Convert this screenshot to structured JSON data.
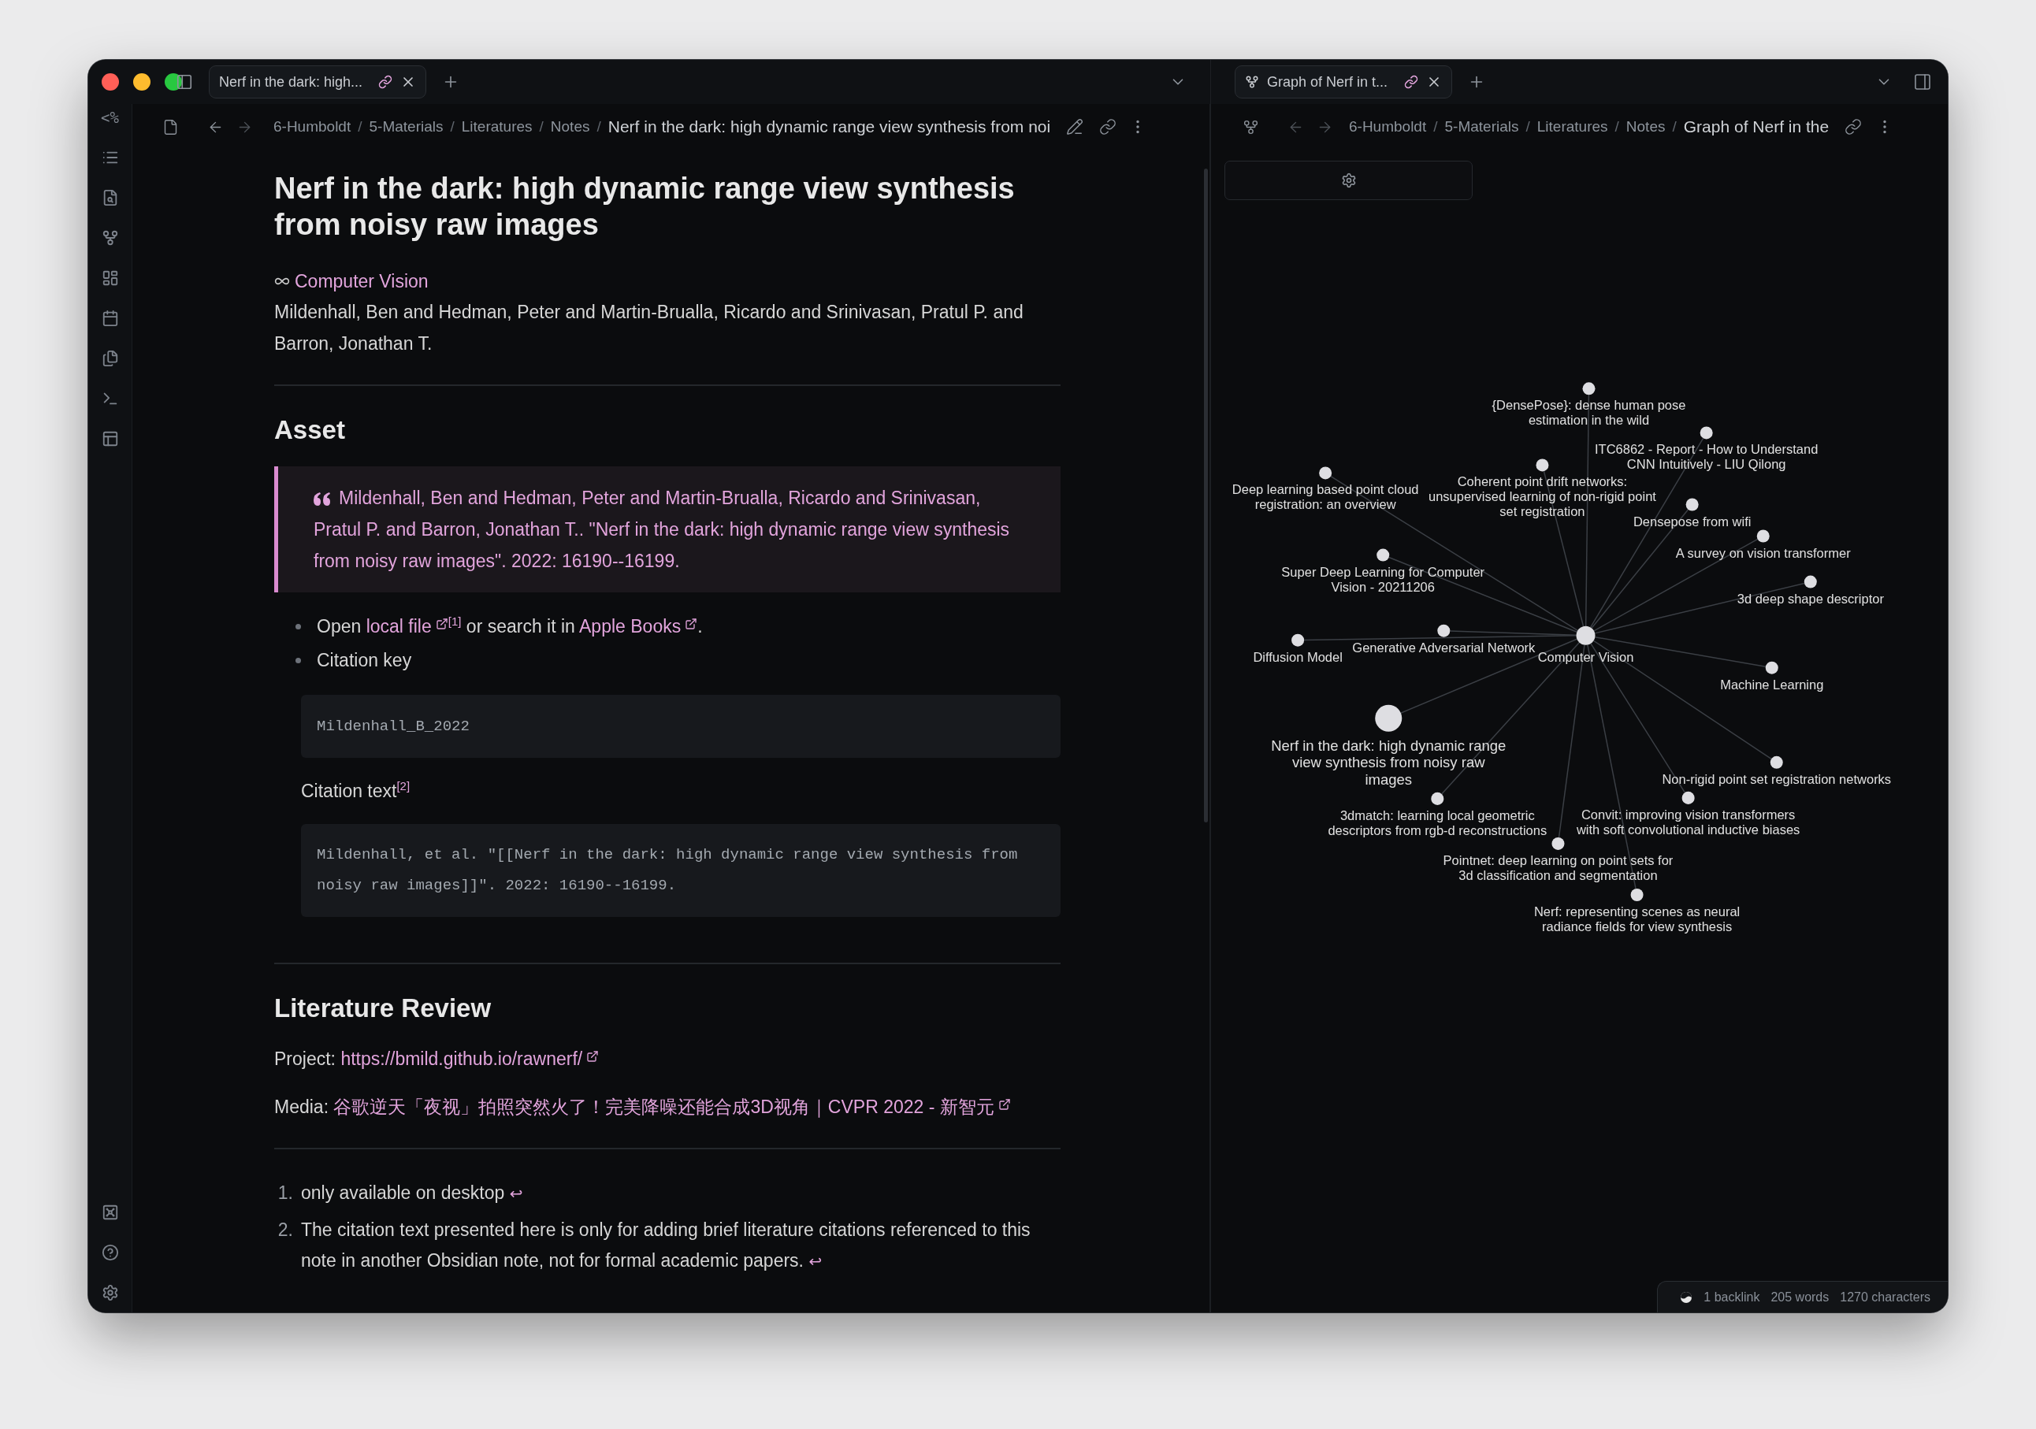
{
  "ribbon": {
    "top_icon_text": "<%"
  },
  "left_pane": {
    "tab": {
      "title": "Nerf in the dark: high...",
      "selected": true
    },
    "breadcrumbs": [
      {
        "label": "6-Humboldt",
        "separator": "/"
      },
      {
        "label": "5-Materials",
        "separator": "/"
      },
      {
        "label": "Literatures",
        "separator": "/"
      },
      {
        "label": "Notes",
        "separator": "/"
      }
    ],
    "current": "Nerf in the dark: high dynamic range view synthesis from noi",
    "note": {
      "title": "Nerf in the dark: high dynamic range view synthesis from noisy raw images",
      "blocks": [
        {
          "kind": "tag",
          "text": "Computer Vision"
        },
        {
          "kind": "paragraph",
          "segments": [
            {
              "kind": "text",
              "text": "Mildenhall, Ben and Hedman, Peter and Martin-Brualla, Ricardo and Srinivasan, Pratul P. and Barron, Jonathan T."
            }
          ]
        },
        {
          "kind": "rule"
        },
        {
          "kind": "heading",
          "text": "Asset"
        },
        {
          "kind": "quote",
          "text": "Mildenhall, Ben and Hedman, Peter and Martin-Brualla, Ricardo and Srinivasan, Pratul P. and Barron, Jonathan T.. \"Nerf in the dark: high dynamic range view synthesis from noisy raw images\". 2022: 16190--16199."
        },
        {
          "kind": "bullet",
          "segments": [
            {
              "kind": "text",
              "text": "Open "
            },
            {
              "kind": "link",
              "text": "local file",
              "external": true
            },
            {
              "kind": "sup",
              "text": "[1]"
            },
            {
              "kind": "text",
              "text": " or search it in "
            },
            {
              "kind": "link",
              "text": "Apple Books",
              "external": true
            },
            {
              "kind": "text",
              "text": "."
            }
          ]
        },
        {
          "kind": "bullet",
          "segments": [
            {
              "kind": "text",
              "text": "Citation key"
            }
          ]
        },
        {
          "kind": "code",
          "text": "Mildenhall_B_2022"
        },
        {
          "kind": "indented",
          "segments": [
            {
              "kind": "text",
              "text": "Citation text"
            },
            {
              "kind": "sup",
              "text": "[2]"
            }
          ]
        },
        {
          "kind": "code",
          "text": "Mildenhall, et al. \"[[Nerf in the dark: high dynamic range view synthesis from noisy raw images]]\". 2022: 16190--16199."
        },
        {
          "kind": "rule"
        },
        {
          "kind": "heading",
          "text": "Literature Review"
        },
        {
          "kind": "paragraph",
          "segments": [
            {
              "kind": "text",
              "text": "Project: "
            },
            {
              "kind": "link",
              "text": "https://bmild.github.io/rawnerf/",
              "external": true
            }
          ]
        },
        {
          "kind": "paragraph",
          "segments": [
            {
              "kind": "text",
              "text": "Media: "
            },
            {
              "kind": "link",
              "text": "谷歌逆天「夜视」拍照突然火了！完美降噪还能合成3D视角｜CVPR 2022 - 新智元",
              "external": true
            }
          ]
        },
        {
          "kind": "rule"
        },
        {
          "kind": "footnotes",
          "items": [
            {
              "number": "1.",
              "segments": [
                {
                  "kind": "text",
                  "text": "only available on desktop "
                },
                {
                  "kind": "backref",
                  "text": "↩"
                }
              ]
            },
            {
              "number": "2.",
              "segments": [
                {
                  "kind": "text",
                  "text": "The citation text presented here is only for adding brief literature citations referenced to this note in another Obsidian note, not for formal academic papers. "
                },
                {
                  "kind": "backref",
                  "text": "↩"
                }
              ]
            }
          ]
        }
      ]
    }
  },
  "right_pane": {
    "tab": {
      "title": "Graph of Nerf in t...",
      "selected": true
    },
    "breadcrumbs": [
      {
        "label": "6-Humboldt",
        "separator": "/"
      },
      {
        "label": "5-Materials",
        "separator": "/"
      },
      {
        "label": "Literatures",
        "separator": "/"
      },
      {
        "label": "Notes",
        "separator": "/"
      }
    ],
    "current": "Graph of Nerf in the",
    "graph": {
      "nodes": [
        {
          "label": "{DensePose}: dense human pose\nestimation in the wild",
          "kind": "note"
        },
        {
          "label": "ITC6862 - Report - How to Understand\nCNN Intuitively - LIU Qilong",
          "kind": "note"
        },
        {
          "label": "Deep learning based point cloud\nregistration: an overview",
          "kind": "note"
        },
        {
          "label": "Coherent point drift networks:\nunsupervised learning of non-rigid point\nset registration",
          "kind": "note"
        },
        {
          "label": "Densepose from wifi",
          "kind": "note"
        },
        {
          "label": "A survey on vision transformer",
          "kind": "note"
        },
        {
          "label": "Super Deep Learning for Computer\nVision - 20211206",
          "kind": "note"
        },
        {
          "label": "3d deep shape descriptor",
          "kind": "note"
        },
        {
          "label": "Diffusion Model",
          "kind": "note"
        },
        {
          "label": "Generative Adversarial Network",
          "kind": "note"
        },
        {
          "label": "Computer Vision",
          "kind": "hub"
        },
        {
          "label": "Machine Learning",
          "kind": "note"
        },
        {
          "label": "Nerf in the dark: high dynamic range\nview synthesis from noisy raw\nimages",
          "kind": "current"
        },
        {
          "label": "Non-rigid point set registration networks",
          "kind": "note"
        },
        {
          "label": "3dmatch: learning local geometric\ndescriptors from rgb-d reconstructions",
          "kind": "note"
        },
        {
          "label": "Convit: improving vision transformers\nwith soft convolutional inductive biases",
          "kind": "note"
        },
        {
          "label": "Pointnet: deep learning on point sets for\n3d classification and segmentation",
          "kind": "note"
        },
        {
          "label": "Nerf: representing scenes as neural\nradiance fields for view synthesis",
          "kind": "note"
        }
      ]
    }
  },
  "status_bar": {
    "items": [
      "1 backlink",
      "205 words",
      "1270 characters"
    ]
  }
}
